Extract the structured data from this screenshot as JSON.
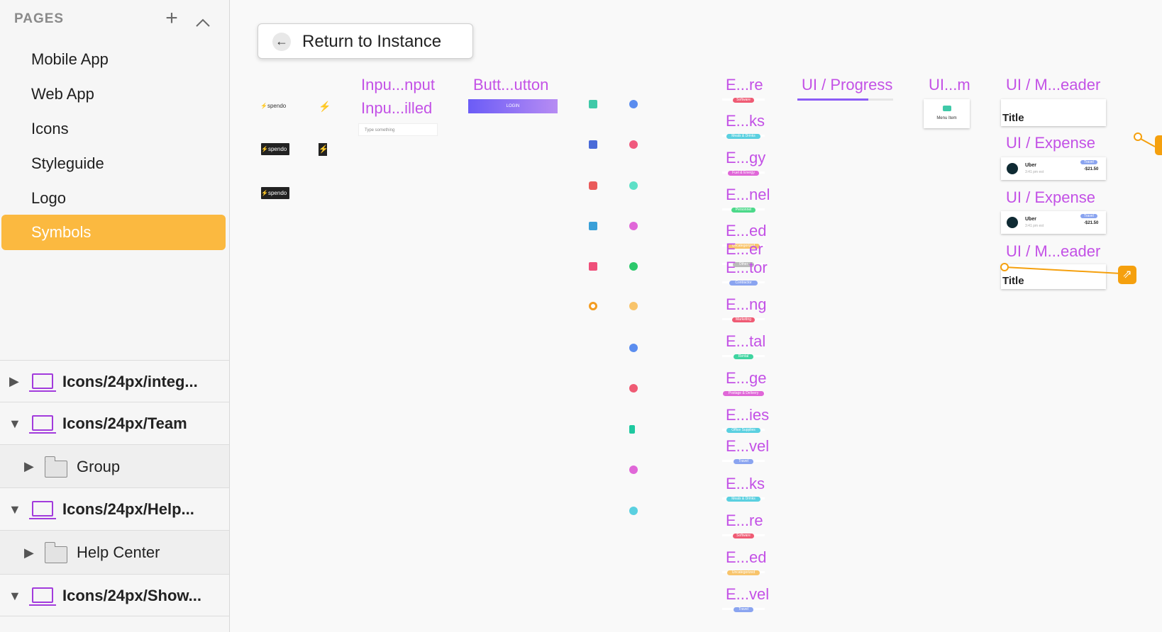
{
  "sidebar": {
    "pages_header": "PAGES",
    "pages": [
      "Mobile App",
      "Web App",
      "Icons",
      "Styleguide",
      "Logo",
      "Symbols"
    ],
    "active_page": "Symbols",
    "layers": [
      {
        "label": "Icons/24px/integ...",
        "type": "artboard",
        "expanded": false
      },
      {
        "label": "Icons/24px/Team",
        "type": "artboard",
        "expanded": true
      },
      {
        "label": "Group",
        "type": "group",
        "expanded": false
      },
      {
        "label": "Icons/24px/Help...",
        "type": "artboard",
        "expanded": true
      },
      {
        "label": "Help Center",
        "type": "group",
        "expanded": false
      },
      {
        "label": "Icons/24px/Show...",
        "type": "artboard",
        "expanded": true
      }
    ]
  },
  "canvas": {
    "return_button": "Return to Instance",
    "symbol_labels": {
      "input1": "Inpu...nput",
      "input2": "Inpu...illed",
      "button": "Butt...utton",
      "progress": "UI / Progress",
      "menu": "UI...m",
      "header1": "UI / M...eader",
      "expense1": "UI / Expense",
      "expense2": "UI / Expense",
      "header2": "UI / M...eader"
    },
    "expense_labels": [
      "E...re",
      "E...ks",
      "E...gy",
      "E...nel",
      "E...ed",
      "E...er",
      "E...tor",
      "E...ng",
      "E...tal",
      "E...ge",
      "E...ies",
      "E...vel",
      "E...ks",
      "E...re",
      "E...ed",
      "E...vel"
    ],
    "expense_badges": [
      "Software",
      "Meals & Drinks",
      "Fuel & Energy",
      "Personnel",
      "Uncategorized",
      "Other",
      "Contractor",
      "Marketing",
      "Rental",
      "Postage & Delivery",
      "Office Supplies",
      "Travel",
      "Meals & Drinks",
      "Software",
      "Uncategorized",
      "Travel"
    ],
    "input_placeholder": "Type something",
    "login_label": "LOGIN",
    "menu_item_label": "Menu Item",
    "header_title": "Title",
    "expense_card": {
      "merchant": "Uber",
      "time": "3:41 pm est",
      "category": "Travel",
      "amount": "-$21.50"
    },
    "logo_text": "spendo",
    "colors": {
      "accent": "#c351e6",
      "active_page": "#fbb940",
      "artboard_icon": "#a23bdc",
      "connector": "#f5a00e"
    }
  }
}
